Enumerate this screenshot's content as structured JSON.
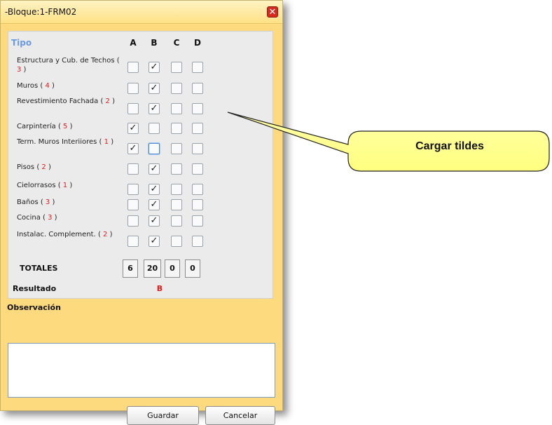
{
  "window": {
    "title": "-Bloque:1-FRM02",
    "close_icon": "close-icon"
  },
  "grid": {
    "tipo_header": "Tipo",
    "columns": [
      "A",
      "B",
      "C",
      "D"
    ],
    "rows": [
      {
        "label": "Estructura y Cub. de Techos",
        "count": "3",
        "checks": [
          false,
          true,
          false,
          false
        ]
      },
      {
        "label": "Muros",
        "count": "4",
        "checks": [
          false,
          true,
          false,
          false
        ]
      },
      {
        "label": "Revestimiento Fachada",
        "count": "2",
        "checks": [
          false,
          true,
          false,
          false
        ]
      },
      {
        "label": "Carpintería",
        "count": "5",
        "checks": [
          true,
          false,
          false,
          false
        ]
      },
      {
        "label": "Term. Muros Interiiores",
        "count": "1",
        "checks": [
          true,
          false,
          false,
          false
        ]
      },
      {
        "label": "Pisos",
        "count": "2",
        "checks": [
          false,
          true,
          false,
          false
        ]
      },
      {
        "label": "Cielorrasos",
        "count": "1",
        "checks": [
          false,
          true,
          false,
          false
        ]
      },
      {
        "label": "Baños",
        "count": "3",
        "checks": [
          false,
          true,
          false,
          false
        ]
      },
      {
        "label": "Cocina",
        "count": "3",
        "checks": [
          false,
          true,
          false,
          false
        ]
      },
      {
        "label": "Instalac. Complement.",
        "count": "2",
        "checks": [
          false,
          true,
          false,
          false
        ]
      }
    ]
  },
  "totals": {
    "label": "TOTALES",
    "values": [
      "6",
      "20",
      "0",
      "0"
    ]
  },
  "result": {
    "label": "Resultado",
    "value": "B"
  },
  "observation": {
    "label": "Observación",
    "value": ""
  },
  "buttons": {
    "save": "Guardar",
    "cancel": "Cancelar"
  },
  "callout": {
    "text": "Cargar tildes"
  },
  "colors": {
    "frame": "#fcda7d",
    "panel": "#ebebeb",
    "count_red": "#e31b1b",
    "tipo_blue": "#6b9be0",
    "callout_fill": "#ffff8f",
    "close_red": "#d52b1e"
  }
}
